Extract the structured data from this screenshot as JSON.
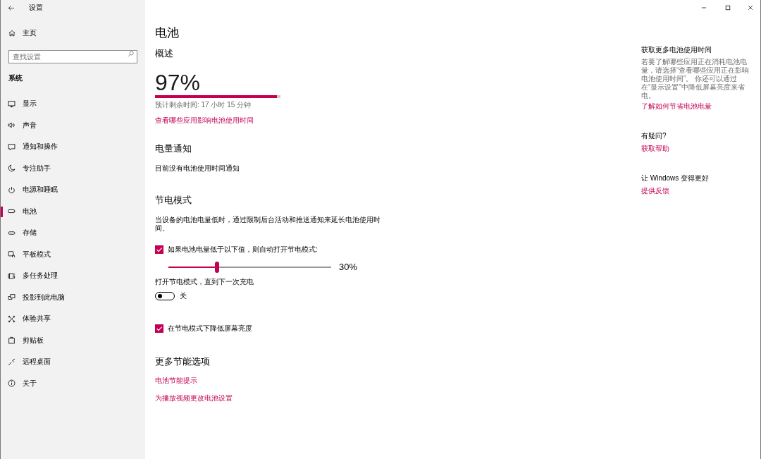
{
  "window": {
    "title": "设置"
  },
  "sidebar": {
    "home": "主页",
    "search": {
      "placeholder": "查找设置"
    },
    "section": "系统",
    "items": [
      {
        "label": "显示",
        "selected": false
      },
      {
        "label": "声音",
        "selected": false
      },
      {
        "label": "通知和操作",
        "selected": false
      },
      {
        "label": "专注助手",
        "selected": false
      },
      {
        "label": "电源和睡眠",
        "selected": false
      },
      {
        "label": "电池",
        "selected": true
      },
      {
        "label": "存储",
        "selected": false
      },
      {
        "label": "平板模式",
        "selected": false
      },
      {
        "label": "多任务处理",
        "selected": false
      },
      {
        "label": "投影到此电脑",
        "selected": false
      },
      {
        "label": "体验共享",
        "selected": false
      },
      {
        "label": "剪贴板",
        "selected": false
      },
      {
        "label": "远程桌面",
        "selected": false
      },
      {
        "label": "关于",
        "selected": false
      }
    ]
  },
  "main": {
    "title": "电池",
    "overview": {
      "heading": "概述",
      "percent": "97%",
      "level": 0.97,
      "estimate": "预计剩余时间: 17 小时 15 分钟",
      "link": "查看哪些应用影响电池使用时间"
    },
    "notifications": {
      "heading": "电量通知",
      "text": "目前没有电池使用时间通知"
    },
    "battery_saver": {
      "heading": "节电模式",
      "description": "当设备的电池电量低时，通过限制后台活动和推送通知来延长电池使用时间。",
      "auto_on": {
        "label": "如果电池电量低于以下值，则自动打开节电模式:",
        "checked": true
      },
      "threshold": {
        "level": 0.3,
        "reading": "30%"
      },
      "until_charge": {
        "label": "打开节电模式，直到下一次充电",
        "on": false,
        "state": "关"
      },
      "lower_brightness": {
        "label": "在节电模式下降低屏幕亮度",
        "checked": true
      }
    },
    "more_options": {
      "heading": "更多节能选项",
      "links": [
        "电池节能提示",
        "为播放视频更改电池设置"
      ]
    }
  },
  "right_panel": {
    "sections": [
      {
        "heading": "获取更多电池使用时间",
        "text": "若要了解哪些应用正在消耗电池电量，请选择“查看哪些应用正在影响电池使用时间”。 你还可以通过在“显示设置”中降低屏幕亮度来省电。",
        "link": "了解如何节省电池电量"
      },
      {
        "heading": "有疑问?",
        "link": "获取帮助"
      },
      {
        "heading": "让 Windows 变得更好",
        "link": "提供反馈"
      }
    ]
  }
}
